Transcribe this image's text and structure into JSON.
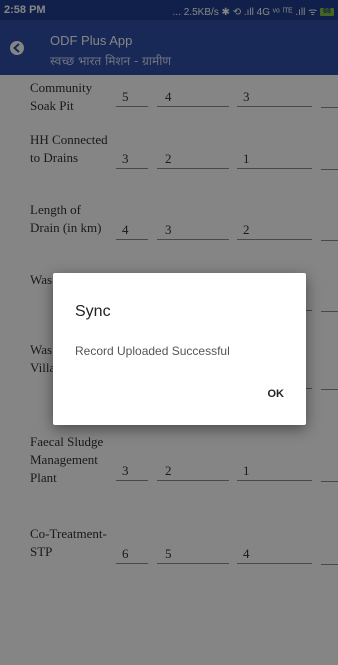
{
  "status_bar": {
    "time": "2:58 PM",
    "indicators": "... 2.5KB/s ✱ ⟲ .ıll 4G  ᵛᵒ ˡᵀᴱ .ıll ᯤ",
    "battery": "68"
  },
  "app_bar": {
    "title": "ODF Plus App",
    "subtitle": "स्वच्छ भारत मिशन - ग्रामीण",
    "back_icon": "back-arrow-icon"
  },
  "table": {
    "rows": [
      {
        "label": "Community Soak Pit",
        "values": [
          "5",
          "4",
          "3",
          ""
        ]
      },
      {
        "label": "HH Connected to Drains",
        "values": [
          "3",
          "2",
          "1",
          ""
        ]
      },
      {
        "label": "Length of Drain (in km)",
        "values": [
          "4",
          "3",
          "2",
          ""
        ]
      },
      {
        "label": "Was Stab Pon",
        "values": [
          "",
          "",
          "",
          ""
        ]
      },
      {
        "label": "Was Coll Unit Villa",
        "values": [
          "",
          "",
          "",
          ""
        ]
      },
      {
        "label": "Faecal Sludge Management Plant",
        "values": [
          "3",
          "2",
          "1",
          ""
        ]
      },
      {
        "label": "Co-Treatment-STP",
        "values": [
          "6",
          "5",
          "4",
          ""
        ]
      }
    ]
  },
  "dialog": {
    "title": "Sync",
    "message": "Record Uploaded Successful",
    "ok_label": "OK"
  }
}
